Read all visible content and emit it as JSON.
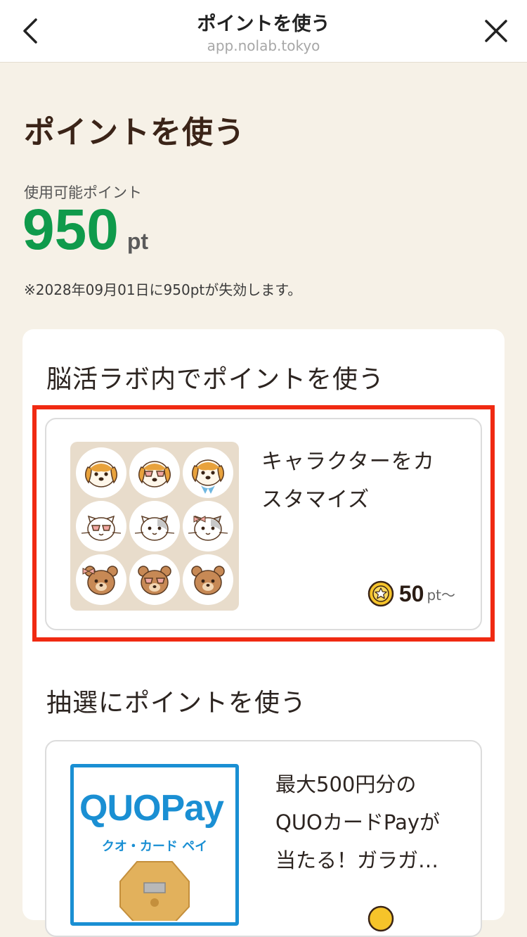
{
  "header": {
    "title": "ポイントを使う",
    "url": "app.nolab.tokyo"
  },
  "page": {
    "title": "ポイントを使う",
    "points_label": "使用可能ポイント",
    "points_value": "950",
    "points_unit": "pt",
    "expiry_note": "※2028年09月01日に950ptが失効します。"
  },
  "section_in_lab": {
    "heading": "脳活ラボ内でポイントを使う",
    "item": {
      "title": "キャラクターをカスタマイズ",
      "price_value": "50",
      "price_unit": "pt〜"
    }
  },
  "section_lottery": {
    "heading": "抽選にポイントを使う",
    "item": {
      "title": "最大500円分のQUOカードPayが当たる！ガラガ…",
      "logo_text": "QUOPay",
      "logo_sub": "クオ・カード ペイ"
    }
  },
  "colors": {
    "accent_green": "#0f9a4b",
    "highlight_red": "#f02a12",
    "quo_blue": "#1a8fd3",
    "background": "#f6f1e7"
  }
}
